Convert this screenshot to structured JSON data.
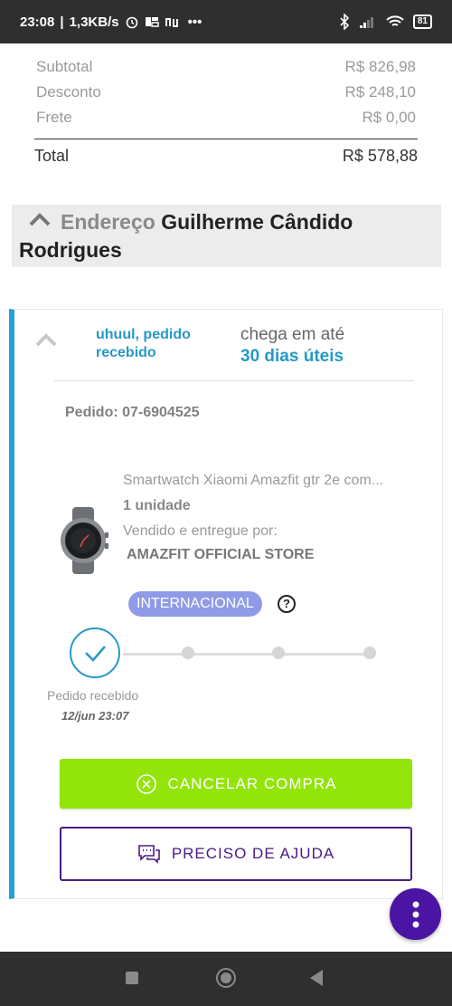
{
  "status_bar": {
    "time": "23:08",
    "network_speed": "1,3KB/s",
    "battery": "81",
    "icons": [
      "alarm-icon",
      "app-icon",
      "nu-icon",
      "more-dots-icon",
      "bluetooth-icon",
      "signal-icon",
      "wifi-icon",
      "battery-icon"
    ]
  },
  "summary": {
    "subtotal_label": "Subtotal",
    "subtotal_value": "R$ 826,98",
    "discount_label": "Desconto",
    "discount_value": "R$ 248,10",
    "shipping_label": "Frete",
    "shipping_value": "R$ 0,00",
    "total_label": "Total",
    "total_value": "R$ 578,88"
  },
  "address": {
    "label": "Endereço",
    "name_line1": "Guilherme Cândido",
    "name_line2": "Rodrigues"
  },
  "order": {
    "status_text": "uhuul, pedido recebido",
    "arrive_label": "chega em até",
    "arrive_value": "30 dias úteis",
    "order_id": "Pedido: 07-6904525",
    "product": {
      "name": "Smartwatch Xiaomi Amazfit gtr 2e com...",
      "quantity": "1 unidade",
      "seller_label": "Vendido e entregue por:",
      "store": "AMAZFIT OFFICIAL STORE"
    },
    "badge": "INTERNACIONAL",
    "help_mark": "?",
    "timeline": {
      "step_label": "Pedido recebido",
      "step_date": "12/jun 23:07"
    },
    "cancel_button": "CANCELAR COMPRA",
    "help_button": "PRECISO DE AJUDA"
  },
  "colors": {
    "accent_blue": "#2699c7",
    "cancel_green": "#93e40a",
    "purple": "#4b1a86",
    "badge": "#8f9be6"
  }
}
